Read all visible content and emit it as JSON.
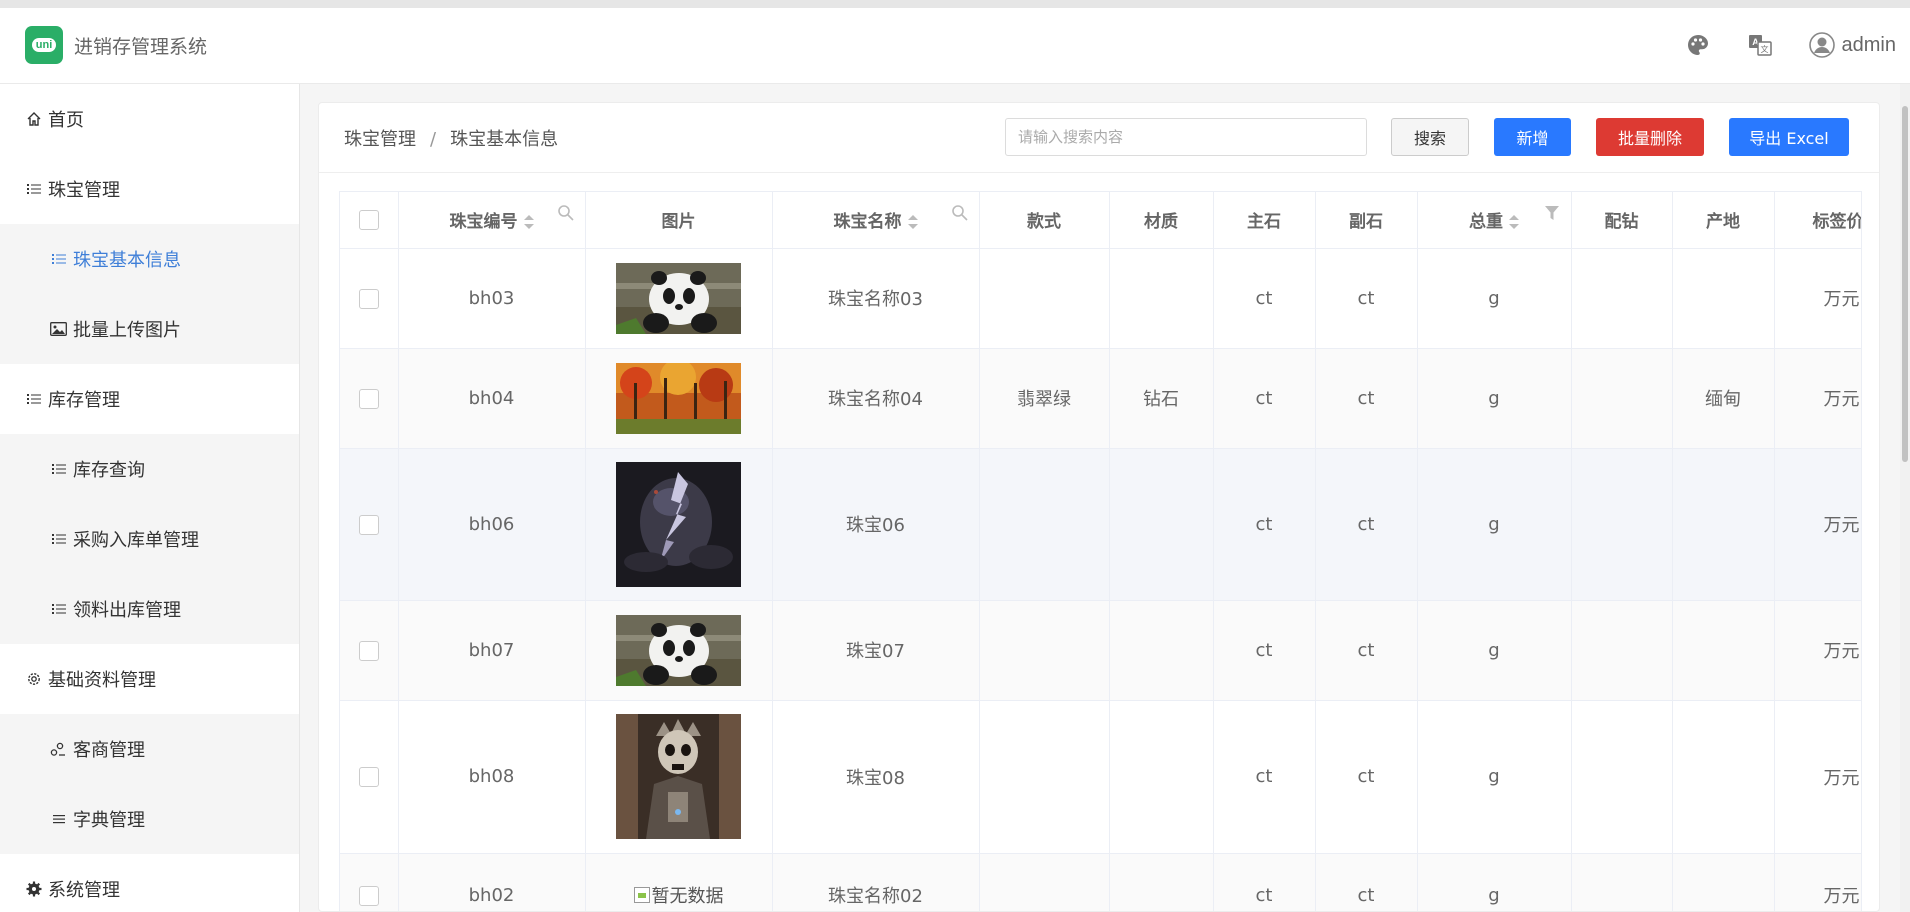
{
  "header": {
    "app_title": "进销存管理系统",
    "logo_text": "uni",
    "user_name": "admin",
    "icons": [
      "palette-icon",
      "translate-icon",
      "user-avatar-icon"
    ]
  },
  "sidebar": {
    "items": [
      {
        "label": "首页",
        "icon": "home-icon",
        "level": 1
      },
      {
        "label": "珠宝管理",
        "icon": "list-icon",
        "level": 1
      },
      {
        "label": "珠宝基本信息",
        "icon": "list-icon",
        "level": 2,
        "active": true
      },
      {
        "label": "批量上传图片",
        "icon": "image-icon",
        "level": 2
      },
      {
        "label": "库存管理",
        "icon": "list-icon",
        "level": 1
      },
      {
        "label": "库存查询",
        "icon": "list-icon",
        "level": 2
      },
      {
        "label": "采购入库单管理",
        "icon": "list-icon",
        "level": 2
      },
      {
        "label": "领料出库管理",
        "icon": "list-icon",
        "level": 2
      },
      {
        "label": "基础资料管理",
        "icon": "gear-icon",
        "level": 1
      },
      {
        "label": "客商管理",
        "icon": "people-icon",
        "level": 2
      },
      {
        "label": "字典管理",
        "icon": "menu-icon",
        "level": 2
      },
      {
        "label": "系统管理",
        "icon": "settings-icon",
        "level": 1
      }
    ]
  },
  "breadcrumb": {
    "parent": "珠宝管理",
    "separator": "/",
    "current": "珠宝基本信息"
  },
  "toolbar": {
    "search_placeholder": "请输入搜索内容",
    "search_label": "搜索",
    "add_label": "新增",
    "batch_delete_label": "批量删除",
    "export_label": "导出 Excel"
  },
  "colors": {
    "primary": "#2979ff",
    "danger": "#dd3a33",
    "active_nav": "#3f7fd8",
    "logo": "#2aae67"
  },
  "table": {
    "columns": [
      "珠宝编号",
      "图片",
      "珠宝名称",
      "款式",
      "材质",
      "主石",
      "副石",
      "总重",
      "配钻",
      "产地",
      "标签价"
    ],
    "rows": [
      {
        "code": "bh03",
        "image": "panda",
        "name": "珠宝名称03",
        "style": "",
        "material": "",
        "main_stone": "ct",
        "side_stone": "ct",
        "weight": "g",
        "diamond": "",
        "origin": "",
        "price": "万元"
      },
      {
        "code": "bh04",
        "image": "autumn-forest",
        "name": "珠宝名称04",
        "style": "翡翠绿",
        "material": "钻石",
        "main_stone": "ct",
        "side_stone": "ct",
        "weight": "g",
        "diamond": "",
        "origin": "缅甸",
        "price": "万元"
      },
      {
        "code": "bh06",
        "image": "lightning-storm",
        "name": "珠宝06",
        "style": "",
        "material": "",
        "main_stone": "ct",
        "side_stone": "ct",
        "weight": "g",
        "diamond": "",
        "origin": "",
        "price": "万元"
      },
      {
        "code": "bh07",
        "image": "panda",
        "name": "珠宝07",
        "style": "",
        "material": "",
        "main_stone": "ct",
        "side_stone": "ct",
        "weight": "g",
        "diamond": "",
        "origin": "",
        "price": "万元"
      },
      {
        "code": "bh08",
        "image": "skeleton-king",
        "name": "珠宝08",
        "style": "",
        "material": "",
        "main_stone": "ct",
        "side_stone": "ct",
        "weight": "g",
        "diamond": "",
        "origin": "",
        "price": "万元"
      },
      {
        "code": "bh02",
        "image": "none",
        "image_alt": "暂无数据",
        "name": "珠宝名称02",
        "style": "",
        "material": "",
        "main_stone": "ct",
        "side_stone": "ct",
        "weight": "g",
        "diamond": "",
        "origin": "",
        "price": "万元"
      }
    ]
  }
}
